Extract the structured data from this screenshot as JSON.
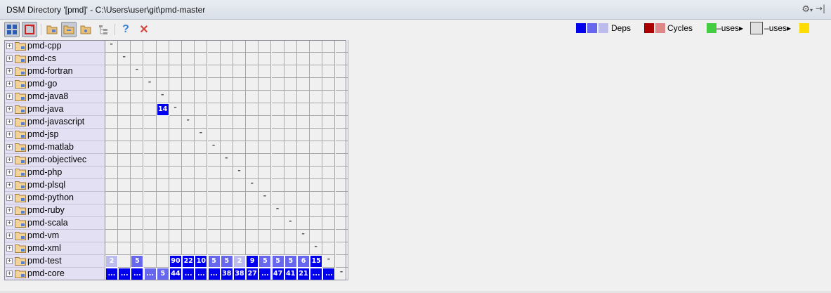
{
  "title": "DSM Directory '[pmd]' - C:\\Users\\user\\git\\pmd-master",
  "title_bar_icons": [
    "gear-icon",
    "hide-panel-icon"
  ],
  "toolbar": {
    "buttons": [
      {
        "name": "expand-matrix-button",
        "icon": "grid-icon",
        "pressed": true
      },
      {
        "name": "toggle-cycles-button",
        "icon": "cycle-icon",
        "pressed": true
      },
      {
        "name": "group-by-directory-button",
        "icon": "folder-group-icon",
        "pressed": false
      },
      {
        "name": "flatten-packages-button",
        "icon": "folder-flat-icon",
        "pressed": true
      },
      {
        "name": "limit-scope-button",
        "icon": "folder-scope-icon",
        "pressed": false
      },
      {
        "name": "show-tree-button",
        "icon": "tree-icon",
        "pressed": false
      },
      {
        "name": "help-button",
        "icon": "help-icon",
        "pressed": false
      },
      {
        "name": "close-button",
        "icon": "close-icon",
        "pressed": false
      }
    ]
  },
  "legend": {
    "deps_label": "Deps",
    "cycles_label": "Cycles",
    "uses_label": "uses",
    "colors": {
      "deps": [
        "#0000ee",
        "#6666ee",
        "#bbbbee"
      ],
      "cycles": [
        "#aa0000",
        "#dd8888"
      ],
      "uses_from": "#44cc44",
      "uses_mid": "#e0e0e0",
      "uses_to": "#ffdd00"
    }
  },
  "modules": [
    "pmd-cpp",
    "pmd-cs",
    "pmd-fortran",
    "pmd-go",
    "pmd-java8",
    "pmd-java",
    "pmd-javascript",
    "pmd-jsp",
    "pmd-matlab",
    "pmd-objectivec",
    "pmd-php",
    "pmd-plsql",
    "pmd-python",
    "pmd-ruby",
    "pmd-scala",
    "pmd-vm",
    "pmd-xml",
    "pmd-test",
    "pmd-core"
  ],
  "diagonal_mark": "-",
  "matrix_cells": [
    {
      "row": 5,
      "col": 4,
      "value": "14",
      "color": "#0000ee"
    },
    {
      "row": 17,
      "col": 0,
      "value": "2",
      "color": "#bbbbee"
    },
    {
      "row": 17,
      "col": 2,
      "value": "5",
      "color": "#6666ee"
    },
    {
      "row": 17,
      "col": 5,
      "value": "90",
      "color": "#0000ee"
    },
    {
      "row": 17,
      "col": 6,
      "value": "22",
      "color": "#0000ee"
    },
    {
      "row": 17,
      "col": 7,
      "value": "10",
      "color": "#0000ee"
    },
    {
      "row": 17,
      "col": 8,
      "value": "5",
      "color": "#6666ee"
    },
    {
      "row": 17,
      "col": 9,
      "value": "5",
      "color": "#6666ee"
    },
    {
      "row": 17,
      "col": 10,
      "value": "2",
      "color": "#bbbbee"
    },
    {
      "row": 17,
      "col": 11,
      "value": "9",
      "color": "#0000ee"
    },
    {
      "row": 17,
      "col": 12,
      "value": "5",
      "color": "#6666ee"
    },
    {
      "row": 17,
      "col": 13,
      "value": "5",
      "color": "#6666ee"
    },
    {
      "row": 17,
      "col": 14,
      "value": "5",
      "color": "#6666ee"
    },
    {
      "row": 17,
      "col": 15,
      "value": "6",
      "color": "#6666ee"
    },
    {
      "row": 17,
      "col": 16,
      "value": "15",
      "color": "#0000ee"
    },
    {
      "row": 18,
      "col": 0,
      "value": "...",
      "color": "#0000ee"
    },
    {
      "row": 18,
      "col": 1,
      "value": "...",
      "color": "#0000ee"
    },
    {
      "row": 18,
      "col": 2,
      "value": "...",
      "color": "#0000ee"
    },
    {
      "row": 18,
      "col": 3,
      "value": "...",
      "color": "#6666ee"
    },
    {
      "row": 18,
      "col": 4,
      "value": "5",
      "color": "#6666ee"
    },
    {
      "row": 18,
      "col": 5,
      "value": "44",
      "color": "#0000ee"
    },
    {
      "row": 18,
      "col": 6,
      "value": "...",
      "color": "#0000ee"
    },
    {
      "row": 18,
      "col": 7,
      "value": "...",
      "color": "#0000ee"
    },
    {
      "row": 18,
      "col": 8,
      "value": "...",
      "color": "#0000ee"
    },
    {
      "row": 18,
      "col": 9,
      "value": "38",
      "color": "#0000ee"
    },
    {
      "row": 18,
      "col": 10,
      "value": "38",
      "color": "#0000ee"
    },
    {
      "row": 18,
      "col": 11,
      "value": "27",
      "color": "#0000ee"
    },
    {
      "row": 18,
      "col": 12,
      "value": "...",
      "color": "#0000ee"
    },
    {
      "row": 18,
      "col": 13,
      "value": "47",
      "color": "#0000ee"
    },
    {
      "row": 18,
      "col": 14,
      "value": "41",
      "color": "#0000ee"
    },
    {
      "row": 18,
      "col": 15,
      "value": "21",
      "color": "#0000ee"
    },
    {
      "row": 18,
      "col": 16,
      "value": "...",
      "color": "#0000ee"
    },
    {
      "row": 18,
      "col": 17,
      "value": "...",
      "color": "#0000ee"
    }
  ]
}
